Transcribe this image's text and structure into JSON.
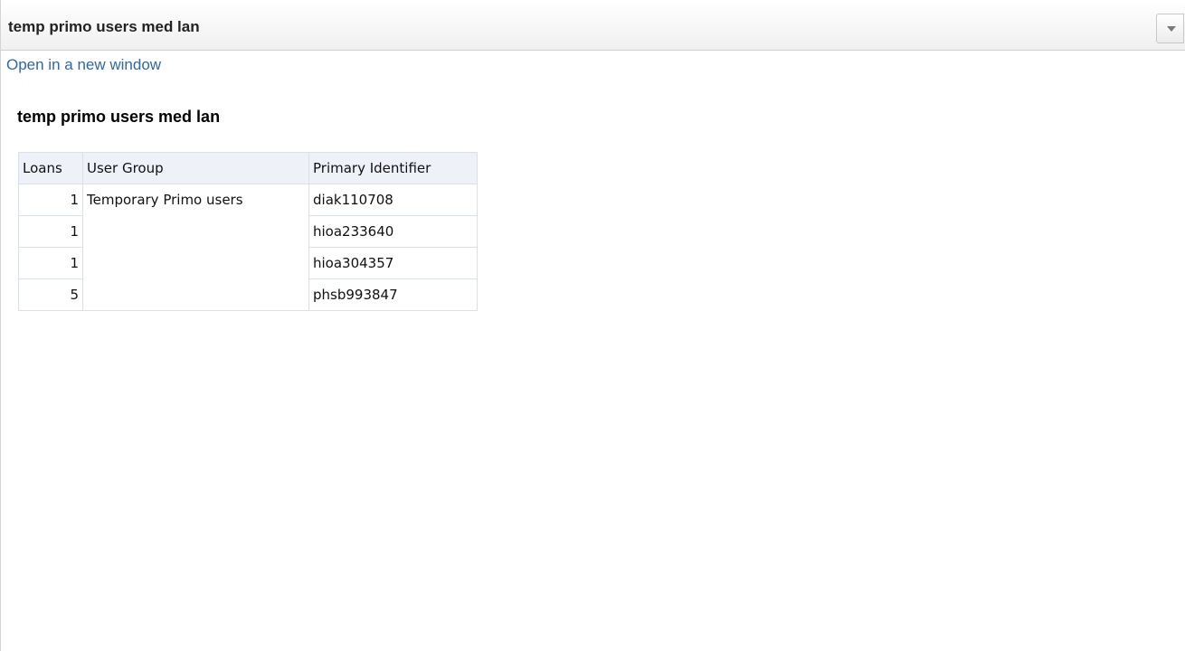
{
  "header": {
    "title": "temp primo users med lan",
    "menu_icon": "chevron-down-icon"
  },
  "link": {
    "open_new_window": "Open in a new window"
  },
  "report": {
    "title": "temp primo users med lan",
    "columns": [
      "Loans",
      "User Group",
      "Primary Identifier"
    ],
    "rows": [
      {
        "loans": "1",
        "user_group": "Temporary Primo users",
        "primary_identifier": "diak110708"
      },
      {
        "loans": "1",
        "user_group": "",
        "primary_identifier": "hioa233640"
      },
      {
        "loans": "1",
        "user_group": "",
        "primary_identifier": "hioa304357"
      },
      {
        "loans": "5",
        "user_group": "",
        "primary_identifier": "phsb993847"
      }
    ]
  }
}
